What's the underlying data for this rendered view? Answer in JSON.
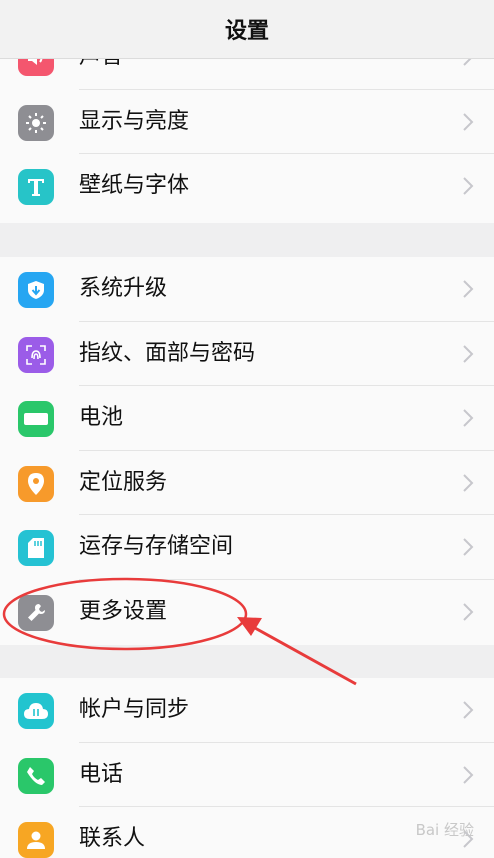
{
  "header": {
    "title": "设置"
  },
  "group1": [
    {
      "name": "sound",
      "label": "声音",
      "icon": "speaker-icon",
      "color": "#f4566e"
    },
    {
      "name": "display-brightness",
      "label": "显示与亮度",
      "icon": "sun-icon",
      "color": "#8e8e93"
    },
    {
      "name": "wallpaper-font",
      "label": "壁纸与字体",
      "icon": "text-t-icon",
      "color": "#27c4c8"
    }
  ],
  "group2": [
    {
      "name": "system-update",
      "label": "系统升级",
      "icon": "shield-arrow-icon",
      "color": "#26a6f2"
    },
    {
      "name": "fingerprint-face-password",
      "label": "指纹、面部与密码",
      "icon": "fingerprint-icon",
      "color": "#9b5ce8"
    },
    {
      "name": "battery",
      "label": "电池",
      "icon": "battery-icon",
      "color": "#2ac76a"
    },
    {
      "name": "location-service",
      "label": "定位服务",
      "icon": "location-pin-icon",
      "color": "#f79a2b"
    },
    {
      "name": "memory-storage",
      "label": "运存与存储空间",
      "icon": "sd-card-icon",
      "color": "#25c2d3"
    },
    {
      "name": "more-settings",
      "label": "更多设置",
      "icon": "wrench-icon",
      "color": "#8e8e93"
    }
  ],
  "group3": [
    {
      "name": "account-sync",
      "label": "帐户与同步",
      "icon": "cloud-sync-icon",
      "color": "#22c4cf"
    },
    {
      "name": "phone",
      "label": "电话",
      "icon": "phone-icon",
      "color": "#2ac76a"
    },
    {
      "name": "contacts",
      "label": "联系人",
      "icon": "person-icon",
      "color": "#f7a623"
    }
  ],
  "annotation": {
    "color": "#e83b3b"
  },
  "watermark": {
    "text": "Bai 经验"
  }
}
